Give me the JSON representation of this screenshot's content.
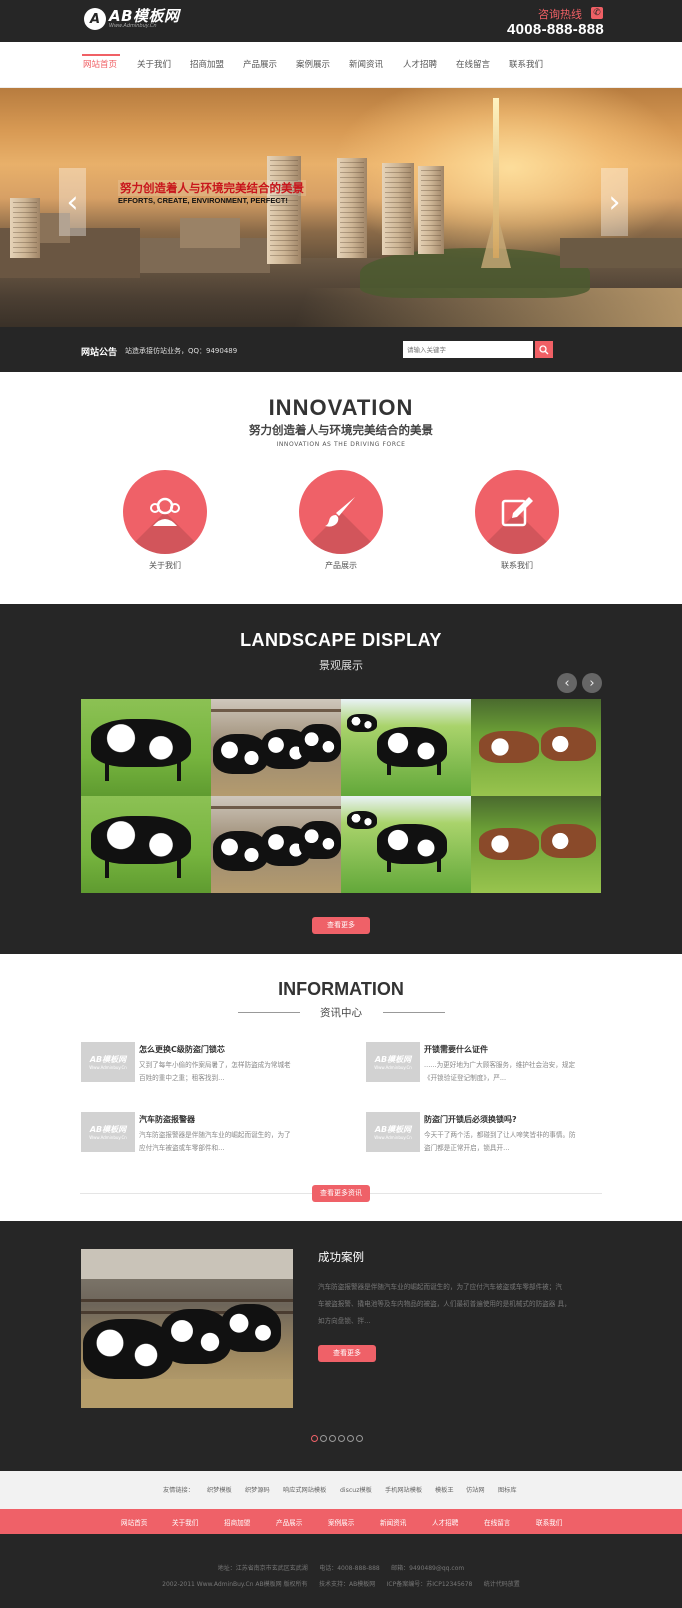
{
  "header": {
    "logo_mark": "A",
    "logo_title": "AB模板网",
    "logo_sub": "Www.Adminbuy.Cn",
    "hotline_label": "咨询热线",
    "hotline_number": "4008-888-888",
    "phone_icon": "phone-icon"
  },
  "nav": {
    "items": [
      "网站首页",
      "关于我们",
      "招商加盟",
      "产品展示",
      "案例展示",
      "新闻资讯",
      "人才招聘",
      "在线留言",
      "联系我们"
    ],
    "active_index": 0
  },
  "banner": {
    "title": "努力创造着人与环境完美结合的美景",
    "subtitle": "EFFORTS, CREATE, ENVIRONMENT, PERFECT!",
    "prev_icon": "‹",
    "next_icon": "›"
  },
  "notice": {
    "label": "网站公告",
    "text": "站造承接仿站业务，QQ：9490489",
    "search_placeholder": "请输入关键字"
  },
  "innovation": {
    "title": "INNOVATION",
    "subtitle": "努力创造着人与环境完美结合的美景",
    "eng": "INNOVATION AS THE DRIVING FORCE",
    "features": [
      {
        "label": "关于我们",
        "icon": "users-icon"
      },
      {
        "label": "产品展示",
        "icon": "brush-icon"
      },
      {
        "label": "联系我们",
        "icon": "edit-icon"
      }
    ]
  },
  "landscape": {
    "title": "LANDSCAPE DISPLAY",
    "subtitle": "景观展示",
    "prev": "‹",
    "next": "›",
    "more_button": "查看更多"
  },
  "information": {
    "title": "INFORMATION",
    "subtitle": "资讯中心",
    "thumb_title": "AB模板网",
    "thumb_sub": "Www.Adminbuy.Cn",
    "news": [
      {
        "title": "怎么更换C级防盗门锁芯",
        "desc1": "又到了每年小偷的作案局暑了，怎样防盗成为常城老",
        "desc2": "百姓的重中之重；租客找到..."
      },
      {
        "title": "开锁需要什么证件",
        "desc1": "......为更好地为广大顾客服务，维护社会治安，规定",
        "desc2": "《开锁验证登记制度》，严..."
      },
      {
        "title": "汽车防盗报警器",
        "desc1": "汽车防盗报警器是伴随汽车业的崛起而诞生的，为了",
        "desc2": "应付汽车被盗或车零部件和..."
      },
      {
        "title": "防盗门开锁后必须换锁吗?",
        "desc1": "今天干了两个活，都碰到了让人啼笑皆非的事情。防",
        "desc2": "盗门都是正常开启，锁具开..."
      }
    ],
    "more_button": "查看更多资讯"
  },
  "case": {
    "title": "成功案例",
    "desc1": "汽车防盗报警器是伴随汽车业的崛起而诞生的，为了应付汽车被盗或车零部件被；汽",
    "desc2": "车被盗报警、撬电池等及车内物品的被盗，人们最初普遍使用的是机械式的防盗器 具，",
    "desc3": "如方向盘锁、拌...",
    "more_button": "查看更多",
    "dots": 6,
    "active_dot": 0
  },
  "links": {
    "label": "友情链接：",
    "items": [
      "织梦模板",
      "织梦源码",
      "响应式网站模板",
      "discuz模板",
      "手机网站模板",
      "模板王",
      "仿站网",
      "图标库"
    ]
  },
  "footer_nav": {
    "items": [
      "网站首页",
      "关于我们",
      "招商加盟",
      "产品展示",
      "案例展示",
      "新闻资讯",
      "人才招聘",
      "在线留言",
      "联系我们"
    ]
  },
  "footer": {
    "line1": "地址：江苏省南京市玄武区玄武湖      电话：4008-888-888      邮箱：9490489@qq.com",
    "line2": "2002-2011 Www.AdminBuy.Cn AB模板网 版权所有      技术支持：AB模板网      ICP备案编号：苏ICP12345678      统计代码放置"
  },
  "colors": {
    "accent": "#ef6168",
    "dark": "#262626"
  }
}
